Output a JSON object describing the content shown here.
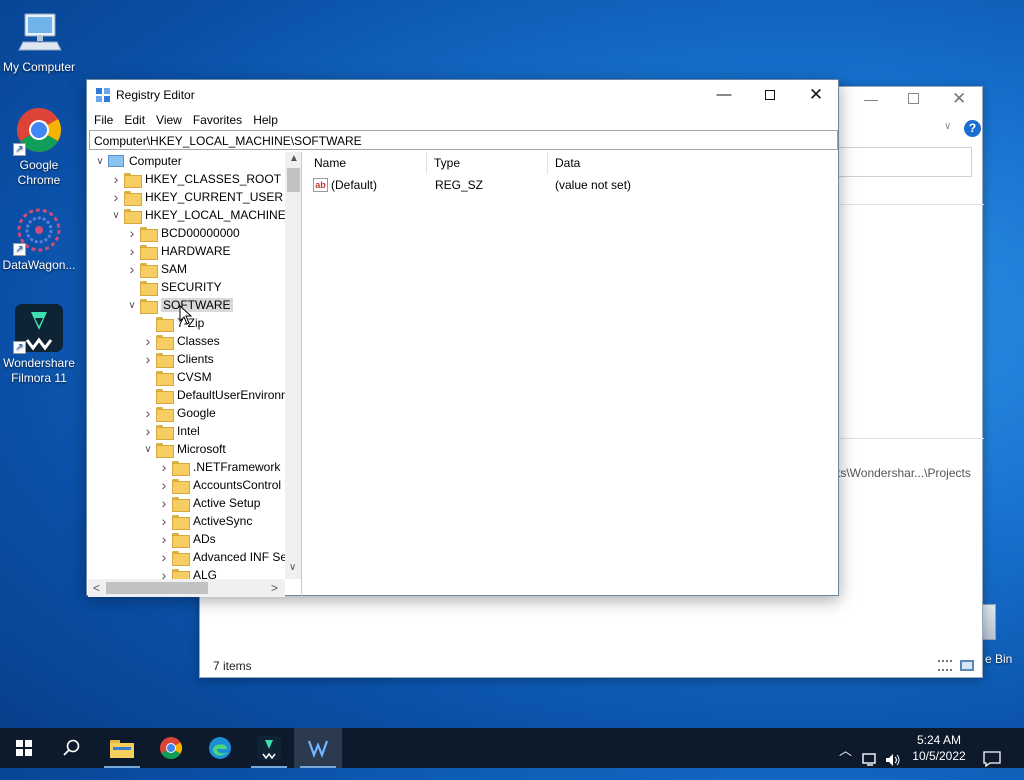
{
  "desktop": {
    "icons": [
      {
        "label": "My Computer",
        "icon": "computer-icon"
      },
      {
        "label": "Google Chrome",
        "icon": "chrome-icon"
      },
      {
        "label": "DataWagon...",
        "icon": "datawagon-icon"
      },
      {
        "label": "Wondershare Filmora 11",
        "icon": "filmora-icon"
      },
      {
        "label": "e Bin",
        "icon": "recycle-bin-icon"
      }
    ]
  },
  "explorer_window": {
    "path_text": "ts\\Wondershar...\\Projects",
    "status": "7 items"
  },
  "regedit": {
    "title": "Registry Editor",
    "menu": [
      "File",
      "Edit",
      "View",
      "Favorites",
      "Help"
    ],
    "address": "Computer\\HKEY_LOCAL_MACHINE\\SOFTWARE",
    "tree": [
      {
        "label": "Computer",
        "level": 0,
        "state": "expanded",
        "icon": "computer-icon"
      },
      {
        "label": "HKEY_CLASSES_ROOT",
        "level": 1,
        "state": "collapsed"
      },
      {
        "label": "HKEY_CURRENT_USER",
        "level": 1,
        "state": "collapsed"
      },
      {
        "label": "HKEY_LOCAL_MACHINE",
        "level": 1,
        "state": "expanded"
      },
      {
        "label": "BCD00000000",
        "level": 2,
        "state": "collapsed"
      },
      {
        "label": "HARDWARE",
        "level": 2,
        "state": "collapsed"
      },
      {
        "label": "SAM",
        "level": 2,
        "state": "collapsed"
      },
      {
        "label": "SECURITY",
        "level": 2,
        "state": "leaf"
      },
      {
        "label": "SOFTWARE",
        "level": 2,
        "state": "expanded",
        "selected": true
      },
      {
        "label": "7-Zip",
        "level": 3,
        "state": "leaf"
      },
      {
        "label": "Classes",
        "level": 3,
        "state": "collapsed"
      },
      {
        "label": "Clients",
        "level": 3,
        "state": "collapsed"
      },
      {
        "label": "CVSM",
        "level": 3,
        "state": "leaf"
      },
      {
        "label": "DefaultUserEnvironn",
        "level": 3,
        "state": "leaf"
      },
      {
        "label": "Google",
        "level": 3,
        "state": "collapsed"
      },
      {
        "label": "Intel",
        "level": 3,
        "state": "collapsed"
      },
      {
        "label": "Microsoft",
        "level": 3,
        "state": "expanded"
      },
      {
        "label": ".NETFramework",
        "level": 4,
        "state": "collapsed"
      },
      {
        "label": "AccountsControl",
        "level": 4,
        "state": "collapsed"
      },
      {
        "label": "Active Setup",
        "level": 4,
        "state": "collapsed"
      },
      {
        "label": "ActiveSync",
        "level": 4,
        "state": "collapsed"
      },
      {
        "label": "ADs",
        "level": 4,
        "state": "collapsed"
      },
      {
        "label": "Advanced INF Set",
        "level": 4,
        "state": "collapsed"
      },
      {
        "label": "ALG",
        "level": 4,
        "state": "collapsed"
      }
    ],
    "columns": [
      "Name",
      "Type",
      "Data"
    ],
    "values": [
      {
        "name": "(Default)",
        "type": "REG_SZ",
        "data": "(value not set)",
        "icon": "string-value-icon"
      }
    ]
  },
  "taskbar": {
    "apps": [
      "start-icon",
      "search-icon",
      "file-explorer-icon",
      "chrome-icon",
      "edge-icon",
      "filmora-icon",
      "datawagon-icon"
    ],
    "time": "5:24 AM",
    "date": "10/5/2022"
  },
  "colors": {
    "folder": "#f5cd62",
    "selection": "#d9d9d9",
    "taskbar": "#0c1a2c"
  }
}
